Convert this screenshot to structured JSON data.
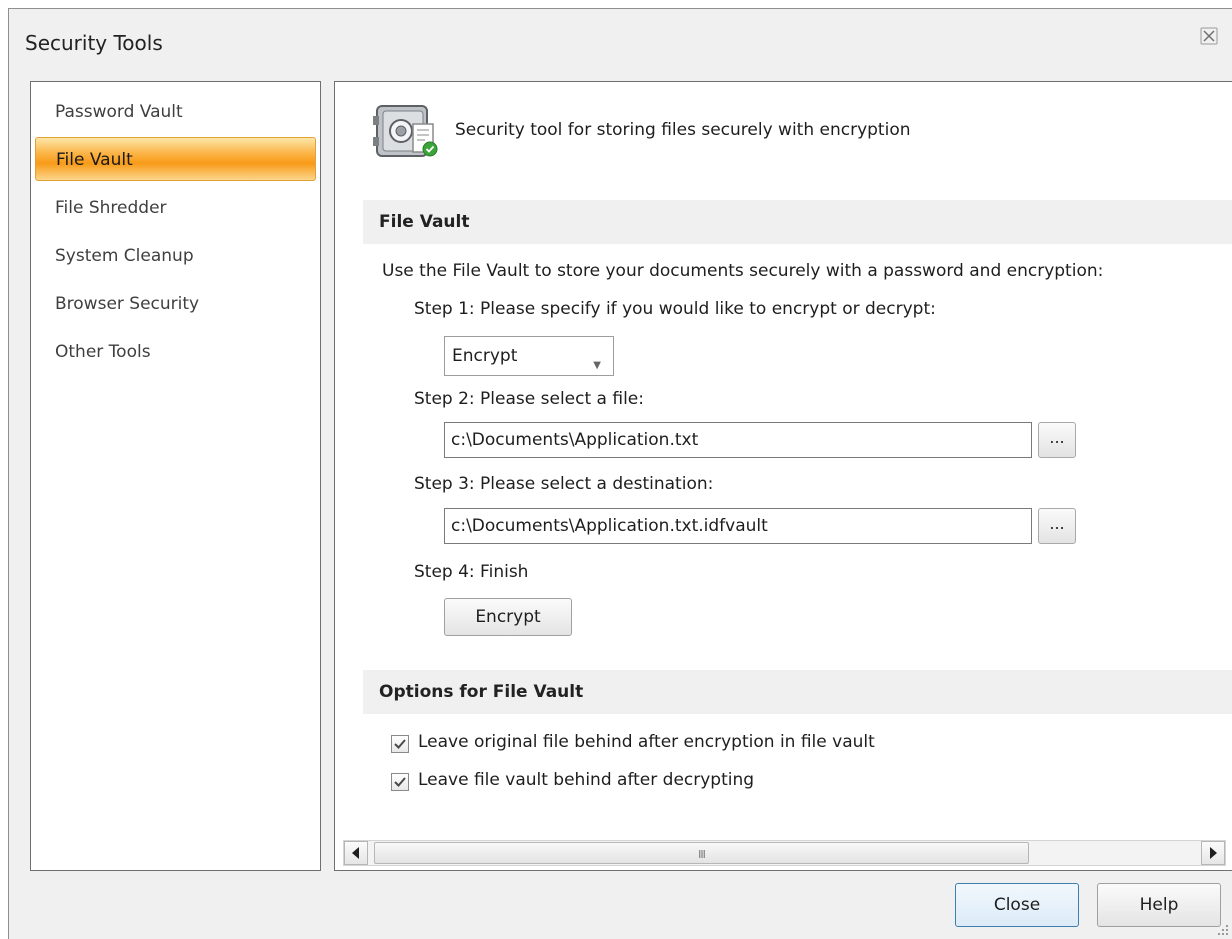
{
  "window": {
    "title": "Security Tools"
  },
  "sidebar": {
    "items": [
      {
        "label": "Password Vault",
        "selected": false
      },
      {
        "label": "File Vault",
        "selected": true
      },
      {
        "label": "File Shredder",
        "selected": false
      },
      {
        "label": "System Cleanup",
        "selected": false
      },
      {
        "label": "Browser Security",
        "selected": false
      },
      {
        "label": "Other Tools",
        "selected": false
      }
    ]
  },
  "main": {
    "header": {
      "icon": "vault-icon",
      "description": "Security tool for storing files securely with encryption"
    },
    "file_vault_section": {
      "title": "File Vault",
      "intro": "Use the File Vault to store your documents securely with a password and encryption:",
      "step1": {
        "label": "Step 1:  Please specify if you would like to encrypt or decrypt:",
        "selected_mode": "Encrypt"
      },
      "step2": {
        "label": "Step 2:  Please select a file:",
        "file_path": "c:\\Documents\\Application.txt",
        "browse_label": "..."
      },
      "step3": {
        "label": "Step 3:  Please select a destination:",
        "destination_path": "c:\\Documents\\Application.txt.idfvault",
        "browse_label": "..."
      },
      "step4": {
        "label": "Step 4:  Finish",
        "action_label": "Encrypt"
      }
    },
    "options_section": {
      "title": "Options for File Vault",
      "options": [
        {
          "label": "Leave original file behind after encryption in file vault",
          "checked": true
        },
        {
          "label": "Leave file vault behind after decrypting",
          "checked": true
        }
      ]
    },
    "scrollbar": {
      "grip_label": "III"
    }
  },
  "footer": {
    "close_label": "Close",
    "help_label": "Help"
  },
  "colors": {
    "selection": "#f89a18",
    "section_bg": "#f0f0f0",
    "window_bg": "#f0f0f0"
  }
}
